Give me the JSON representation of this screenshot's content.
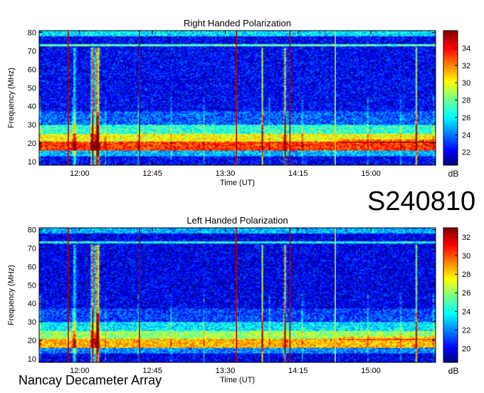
{
  "session_label": "S240810",
  "instrument_label": "Nancay Decameter Array",
  "chart_data": [
    {
      "type": "heatmap",
      "title": "Right Handed Polarization",
      "xlabel": "Time (UT)",
      "ylabel": "Frequency (MHz)",
      "colorbar_label": "dB",
      "colormap": "jet",
      "xlim": [
        "11:35",
        "15:40"
      ],
      "ylim": [
        8,
        81
      ],
      "x_ticks": [
        "12:00",
        "12:45",
        "13:30",
        "14:15",
        "15:00"
      ],
      "y_ticks": [
        10,
        20,
        30,
        40,
        50,
        60,
        70,
        80
      ],
      "clim": [
        20.5,
        36
      ],
      "colorbar_ticks": [
        22,
        24,
        26,
        28,
        30,
        32,
        34
      ]
    },
    {
      "type": "heatmap",
      "title": "Left Handed Polarization",
      "xlabel": "Time (UT)",
      "ylabel": "Frequency (MHz)",
      "colorbar_label": "dB",
      "colormap": "jet",
      "xlim": [
        "11:35",
        "15:40"
      ],
      "ylim": [
        8,
        81
      ],
      "x_ticks": [
        "12:00",
        "12:45",
        "13:30",
        "14:15",
        "15:00"
      ],
      "y_ticks": [
        10,
        20,
        30,
        40,
        50,
        60,
        70,
        80
      ],
      "clim": [
        18.5,
        33
      ],
      "colorbar_ticks": [
        20,
        22,
        24,
        26,
        28,
        30,
        32
      ]
    }
  ]
}
